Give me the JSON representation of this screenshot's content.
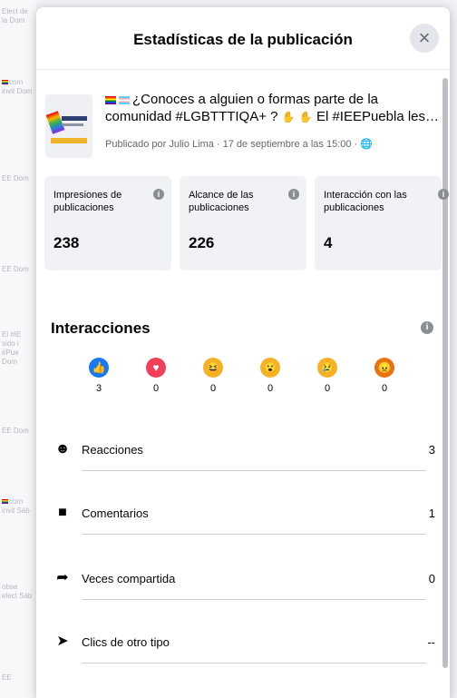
{
  "dialog": {
    "title": "Estadísticas de la publicación",
    "close_label": "×"
  },
  "post": {
    "line1": "¿Conoces a alguien o formas parte de la",
    "line2": "comunidad #LGBTTTIQA+ ?",
    "line2b": "El #IEEPuebla les invi...",
    "meta": "Publicado por Julio Lima · 17 de septiembre a las 15:00 ·"
  },
  "cards": [
    {
      "label": "Impresiones de publicaciones",
      "value": "238"
    },
    {
      "label": "Alcance de las publicaciones",
      "value": "226"
    },
    {
      "label": "Interacción con las publicaciones",
      "value": "4"
    }
  ],
  "interactions": {
    "title": "Interacciones",
    "reactions": [
      {
        "name": "like",
        "count": "3",
        "color": "#1877f2",
        "glyph": "👍"
      },
      {
        "name": "love",
        "count": "0",
        "color": "#f33e58",
        "glyph": "♥"
      },
      {
        "name": "haha",
        "count": "0",
        "color": "#f7b125",
        "glyph": "😆"
      },
      {
        "name": "wow",
        "count": "0",
        "color": "#f7b125",
        "glyph": "😮"
      },
      {
        "name": "sad",
        "count": "0",
        "color": "#f7b125",
        "glyph": "😢"
      },
      {
        "name": "angry",
        "count": "0",
        "color": "#e9710f",
        "glyph": "😠"
      }
    ]
  },
  "metrics": [
    {
      "label": "Reacciones",
      "value": "3",
      "icon": "smiley-icon"
    },
    {
      "label": "Comentarios",
      "value": "1",
      "icon": "comment-icon"
    },
    {
      "label": "Veces compartida",
      "value": "0",
      "icon": "share-icon"
    },
    {
      "label": "Clics de otro tipo",
      "value": "--",
      "icon": "cursor-icon"
    }
  ],
  "background": {
    "items": [
      "Elect de la Dom",
      "com invit Dom",
      "EE Dom",
      "EE Dom",
      "El #IE sido i #Pue Dom",
      "EE Dom",
      "com invit Sáb",
      "obse elect Sáb",
      "EE"
    ]
  }
}
